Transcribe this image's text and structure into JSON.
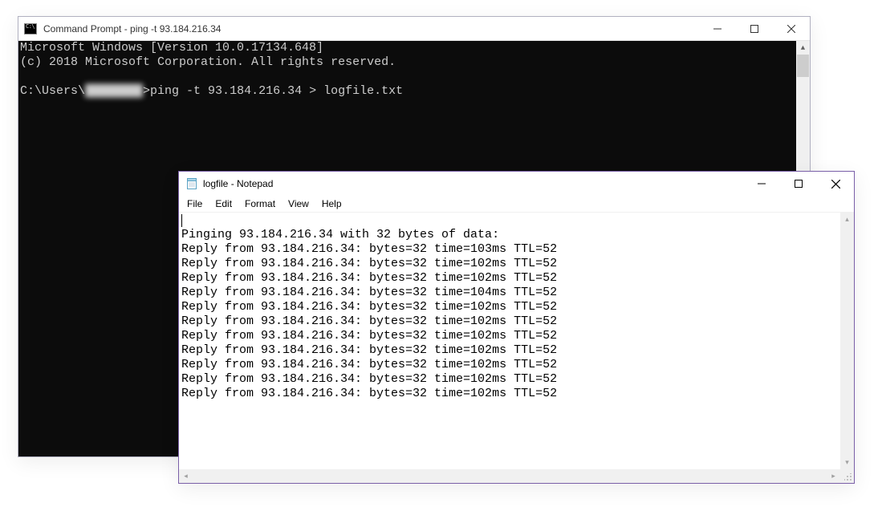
{
  "cmd": {
    "title": "Command Prompt - ping  -t 93.184.216.34",
    "line1": "Microsoft Windows [Version 10.0.17134.648]",
    "line2": "(c) 2018 Microsoft Corporation. All rights reserved.",
    "prompt_prefix": "C:\\Users\\",
    "prompt_user_blurred": "████████",
    "prompt_suffix": ">",
    "prompt_command": "ping -t 93.184.216.34 > logfile.txt"
  },
  "notepad": {
    "title": "logfile - Notepad",
    "menu": {
      "file": "File",
      "edit": "Edit",
      "format": "Format",
      "view": "View",
      "help": "Help"
    },
    "content_lines": [
      "",
      "Pinging 93.184.216.34 with 32 bytes of data:",
      "Reply from 93.184.216.34: bytes=32 time=103ms TTL=52",
      "Reply from 93.184.216.34: bytes=32 time=102ms TTL=52",
      "Reply from 93.184.216.34: bytes=32 time=102ms TTL=52",
      "Reply from 93.184.216.34: bytes=32 time=104ms TTL=52",
      "Reply from 93.184.216.34: bytes=32 time=102ms TTL=52",
      "Reply from 93.184.216.34: bytes=32 time=102ms TTL=52",
      "Reply from 93.184.216.34: bytes=32 time=102ms TTL=52",
      "Reply from 93.184.216.34: bytes=32 time=102ms TTL=52",
      "Reply from 93.184.216.34: bytes=32 time=102ms TTL=52",
      "Reply from 93.184.216.34: bytes=32 time=102ms TTL=52",
      "Reply from 93.184.216.34: bytes=32 time=102ms TTL=52"
    ]
  }
}
